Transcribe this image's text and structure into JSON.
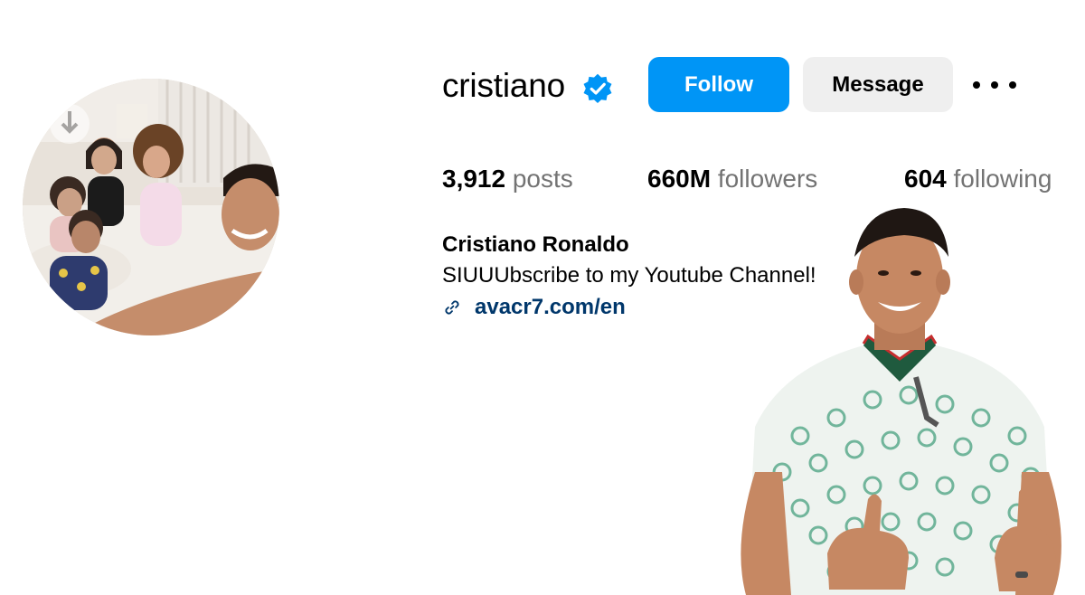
{
  "profile": {
    "username": "cristiano",
    "verified_icon": "verified-badge-icon",
    "full_name": "Cristiano Ronaldo",
    "bio": "SIUUUbscribe to my Youtube Channel!",
    "link_text": "avacr7.com/en",
    "link_icon": "link-icon"
  },
  "actions": {
    "follow_label": "Follow",
    "message_label": "Message",
    "more_icon": "more-options-icon"
  },
  "stats": {
    "posts_count": "3,912",
    "posts_label": "posts",
    "followers_count": "660M",
    "followers_label": "followers",
    "following_count": "604",
    "following_label": "following"
  },
  "colors": {
    "follow_button": "#0095f6",
    "message_button": "#efefef",
    "link": "#00376b",
    "secondary_text": "#737373",
    "verified_badge": "#0095f6"
  }
}
